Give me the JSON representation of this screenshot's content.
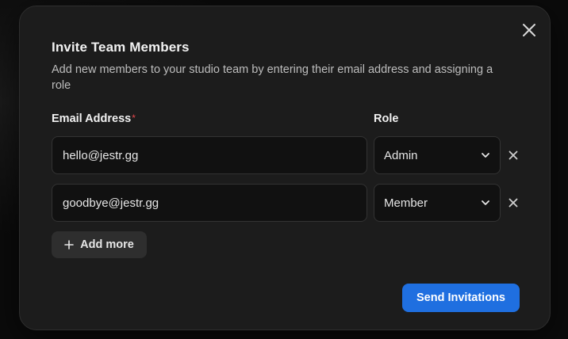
{
  "modal": {
    "title": "Invite Team Members",
    "subtitle": "Add new members to your studio team by entering their email address and assigning a role",
    "close_icon": "close-icon"
  },
  "form": {
    "email_label": "Email Address",
    "required_marker": "*",
    "role_label": "Role",
    "rows": [
      {
        "email": "hello@jestr.gg",
        "role": "Admin"
      },
      {
        "email": "goodbye@jestr.gg",
        "role": "Member"
      }
    ],
    "add_more_label": "Add more",
    "submit_label": "Send Invitations"
  },
  "colors": {
    "modal_background": "#1c1c1c",
    "input_background": "#111111",
    "primary_button": "#1f6fe0",
    "secondary_button": "#2e2e2e",
    "required_marker": "#e5484d"
  },
  "icons": {
    "close": "close-icon",
    "dropdown": "chevron-down-icon",
    "remove_row": "remove-row-icon",
    "add": "plus-icon"
  }
}
